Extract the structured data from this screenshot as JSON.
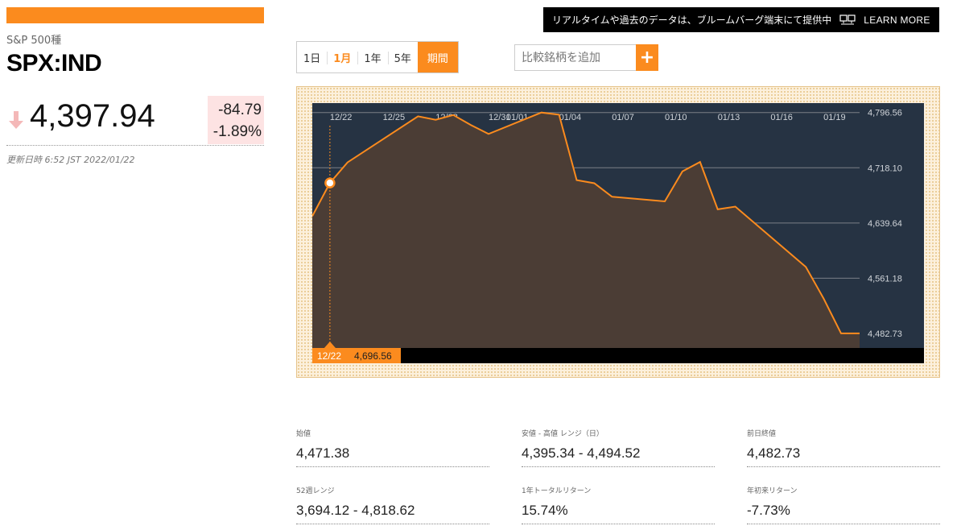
{
  "header": {
    "index_name": "S&P 500種",
    "ticker": "SPX:IND",
    "price": "4,397.94",
    "change": "-84.79",
    "change_pct": "-1.89%",
    "updated": "更新日時 6:52 JST 2022/01/22",
    "direction_icon": "arrow-down-icon",
    "down_color": "#f4b8b8"
  },
  "banner": {
    "text": "リアルタイムや過去のデータは、ブルームバーグ端末にて提供中",
    "icon": "terminal-monitor-icon",
    "learn_more": "LEARN MORE"
  },
  "tabs": [
    {
      "label": "1日",
      "active": false
    },
    {
      "label": "1月",
      "active": true
    },
    {
      "label": "1年",
      "active": false
    },
    {
      "label": "5年",
      "active": false
    },
    {
      "label": "期間",
      "active": false
    }
  ],
  "compare": {
    "placeholder": "比較銘柄を追加",
    "add_label": "+"
  },
  "colors": {
    "accent": "#fb8b1e",
    "chart_bg": "#263343",
    "area_fill": "#4b3d35"
  },
  "chart_data": {
    "type": "area",
    "x_ticks": [
      "12/22",
      "12/25",
      "12/28",
      "12/31",
      "01/01",
      "01/04",
      "01/07",
      "01/10",
      "01/13",
      "01/16",
      "01/19"
    ],
    "y_ticks": [
      "4,796.56",
      "4,718.10",
      "4,639.64",
      "4,561.18",
      "4,482.73"
    ],
    "ylim": [
      4462,
      4810
    ],
    "x": [
      "12/21",
      "12/22",
      "12/23",
      "12/27",
      "12/28",
      "12/29",
      "12/30",
      "12/31",
      "01/03",
      "01/04",
      "01/05",
      "01/06",
      "01/07",
      "01/10",
      "01/11",
      "01/12",
      "01/13",
      "01/14",
      "01/18",
      "01/19",
      "01/20",
      "01/21"
    ],
    "values": [
      4649.23,
      4696.56,
      4725.79,
      4791.19,
      4786.35,
      4793.06,
      4778.73,
      4766.18,
      4796.56,
      4793.54,
      4700.58,
      4696.05,
      4677.03,
      4670.29,
      4713.07,
      4726.35,
      4659.03,
      4662.85,
      4577.11,
      4532.76,
      4482.73,
      4482.73
    ],
    "crosshair": {
      "date": "12/22",
      "value": "4,696.56"
    }
  },
  "stats": [
    {
      "label": "始値",
      "value": "4,471.38"
    },
    {
      "label": "安値 - 高値 レンジ（日）",
      "value": "4,395.34 - 4,494.52"
    },
    {
      "label": "前日終値",
      "value": "4,482.73"
    },
    {
      "label": "52週レンジ",
      "value": "3,694.12 - 4,818.62"
    },
    {
      "label": "1年トータルリターン",
      "value": "15.74%"
    },
    {
      "label": "年初来リターン",
      "value": "-7.73%"
    }
  ]
}
